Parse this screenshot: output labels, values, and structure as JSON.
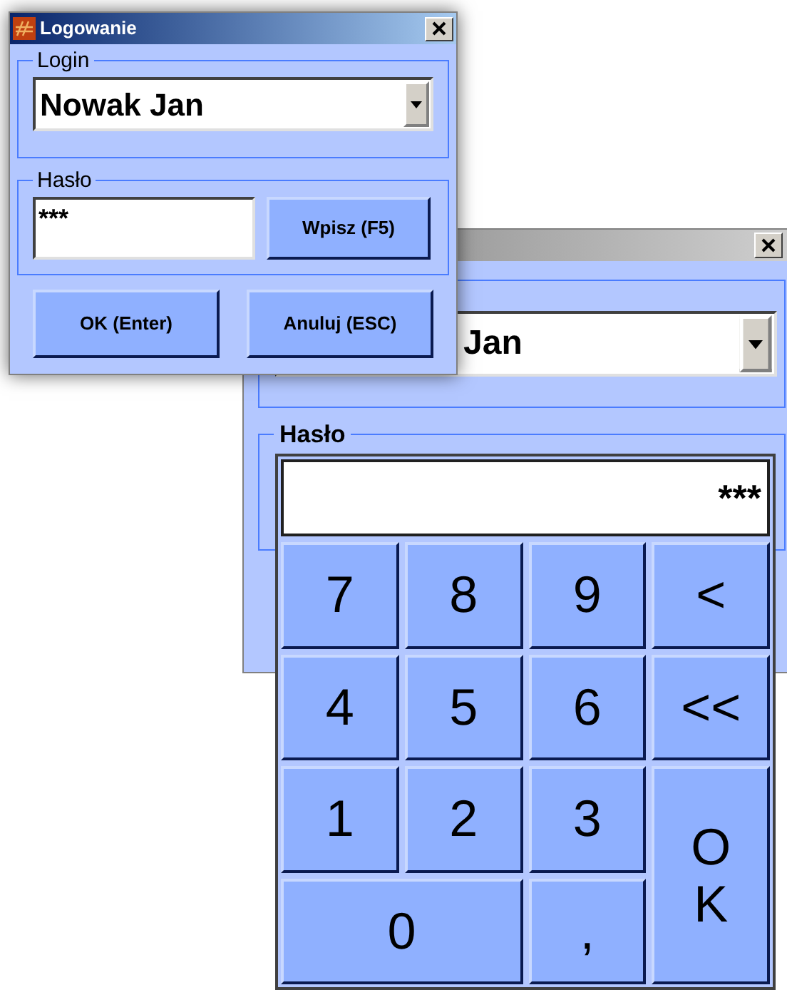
{
  "front_window": {
    "title": "Logowanie",
    "login_group": {
      "label": "Login",
      "value": "Nowak Jan"
    },
    "password_group": {
      "label": "Hasło",
      "value": "***",
      "button": "Wpisz (F5)"
    },
    "buttons": [
      "OK (Enter)",
      "Anuluj (ESC)"
    ]
  },
  "back_window": {
    "login_value": "Jan",
    "password_label": "Hasło"
  },
  "keypad": {
    "display": "***",
    "keys": [
      {
        "label": "7",
        "kind": "key"
      },
      {
        "label": "8",
        "kind": "key"
      },
      {
        "label": "9",
        "kind": "key"
      },
      {
        "label": "<",
        "kind": "key"
      },
      {
        "label": "4",
        "kind": "key"
      },
      {
        "label": "5",
        "kind": "key"
      },
      {
        "label": "6",
        "kind": "key"
      },
      {
        "label": "<<",
        "kind": "key"
      },
      {
        "label": "1",
        "kind": "key"
      },
      {
        "label": "2",
        "kind": "key"
      },
      {
        "label": "3",
        "kind": "key"
      },
      {
        "label": "OK",
        "kind": "tall"
      },
      {
        "label": "0",
        "kind": "wide"
      },
      {
        "label": ",",
        "kind": "key"
      }
    ]
  }
}
